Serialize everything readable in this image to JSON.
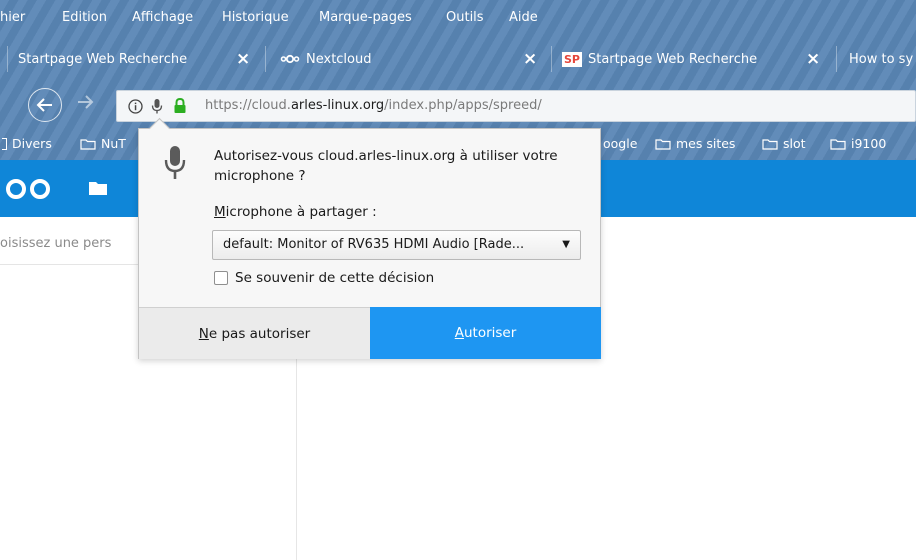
{
  "menubar": {
    "items": [
      "hier",
      "Edition",
      "Affichage",
      "Historique",
      "Marque-pages",
      "Outils",
      "Aide"
    ]
  },
  "tabs": [
    {
      "label": "Startpage Web Recherche",
      "icon": "none"
    },
    {
      "label": "Nextcloud",
      "icon": "nextcloud-icon"
    },
    {
      "label": "Startpage Web Recherche",
      "icon": "startpage-icon",
      "icon_text": "SP"
    },
    {
      "label": "How to sy",
      "icon": "none"
    }
  ],
  "tab_close_glyph": "×",
  "urlbar": {
    "prefix": "https://cloud.",
    "domain": "arles-linux.org",
    "path": "/index.php/apps/spreed/"
  },
  "bookmarks": [
    "Divers",
    "NuT",
    "oogle",
    "mes sites",
    "slot",
    "i9100"
  ],
  "nextcloud": {
    "search_placeholder": "oisissez une pers",
    "brand_color": "#0f86d8"
  },
  "permission_popup": {
    "prompt": "Autorisez-vous cloud.arles-linux.org à utiliser votre microphone ?",
    "share_label": "Microphone à partager :",
    "selected_device": "default: Monitor of RV635 HDMI Audio [Rade...",
    "remember_label": "Se souvenir de cette décision",
    "remember_checked": false,
    "deny_label": "Ne pas autoriser",
    "allow_label": "Autoriser",
    "allow_color": "#1e96f2"
  }
}
